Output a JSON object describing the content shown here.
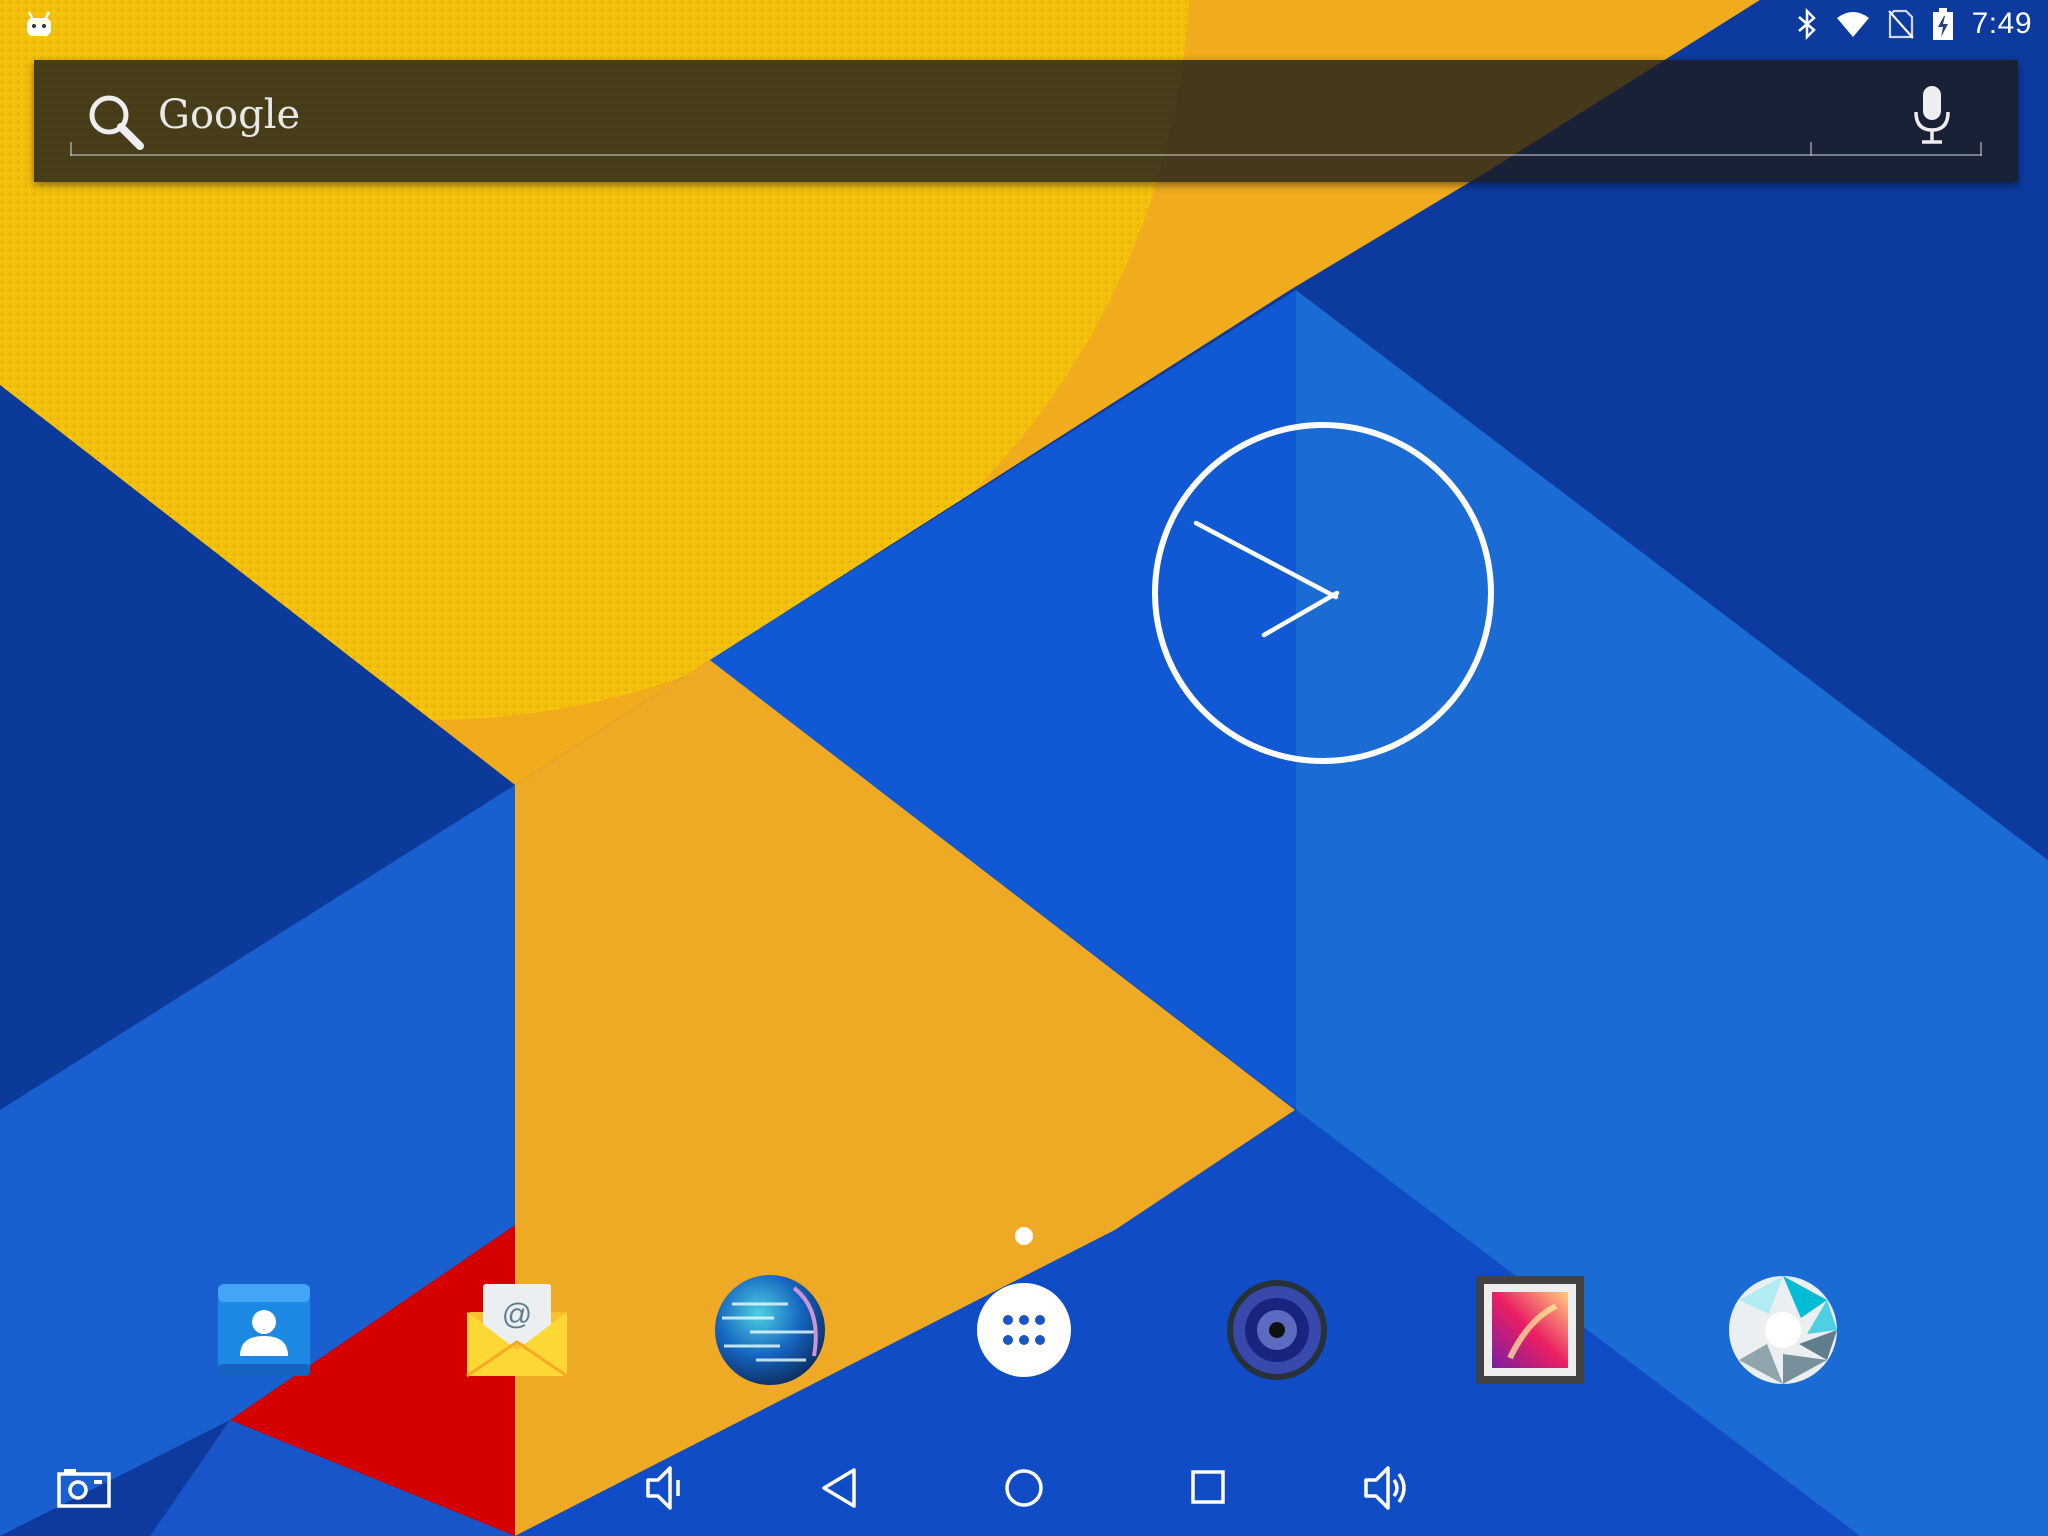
{
  "status_bar": {
    "time": "7:49",
    "icons": [
      "android-notification-icon",
      "bluetooth-icon",
      "wifi-icon",
      "no-sim-icon",
      "battery-charging-icon"
    ]
  },
  "search": {
    "label": "Google",
    "search_icon": "search-icon",
    "voice_icon": "microphone-icon"
  },
  "clock_widget": {
    "type": "analog-clock",
    "time": "7:49"
  },
  "home": {
    "page_count": 1,
    "current_page": 1
  },
  "dock": {
    "apps": [
      {
        "icon": "contacts-icon"
      },
      {
        "icon": "email-icon"
      },
      {
        "icon": "browser-globe-icon"
      },
      {
        "icon": "app-drawer-icon"
      },
      {
        "icon": "music-speaker-icon"
      },
      {
        "icon": "gallery-icon"
      },
      {
        "icon": "camera-icon"
      }
    ]
  },
  "nav_bar": {
    "buttons": [
      "screenshot-icon",
      "volume-down-icon",
      "back-icon",
      "home-icon",
      "recents-icon",
      "volume-up-icon"
    ]
  },
  "colors": {
    "wallpaper_yellow": "#f0b428",
    "wallpaper_blue_dark": "#0d3a9c",
    "wallpaper_blue_mid": "#1256cc",
    "wallpaper_blue_light": "#1b6ad6",
    "wallpaper_red": "#d40000",
    "search_bar_bg": "#1c1c1c"
  }
}
